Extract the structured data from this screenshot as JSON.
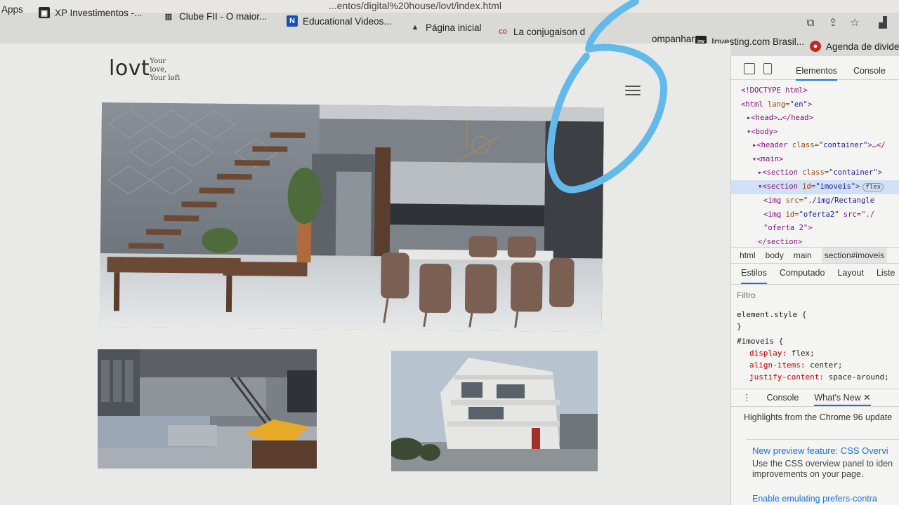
{
  "browser": {
    "url_fragment": "...entos/digital%20house/lovt/index.html",
    "bookmarks": [
      {
        "label": "Apps",
        "icon": "apps-grid-icon"
      },
      {
        "label": "XP Investimentos -...",
        "icon": "xp-favicon-icon"
      },
      {
        "label": "Clube FII - O maior...",
        "icon": "building-icon"
      },
      {
        "label": "Educational Videos...",
        "icon": "n-favicon-icon"
      },
      {
        "label": "Página inicial",
        "icon": "mountain-favicon-icon"
      },
      {
        "label": "La conjugaison d",
        "icon": "conjugaison-favicon-icon"
      },
      {
        "label": "ompanhar",
        "icon": "bookmark-icon"
      },
      {
        "label": "Investing.com Brasil...",
        "icon": "investing-favicon-icon"
      },
      {
        "label": "Agenda de dividen",
        "icon": "agenda-favicon-icon"
      }
    ]
  },
  "page": {
    "logo": "lovt",
    "tagline": [
      "Your",
      "love,",
      "Your loft"
    ],
    "hero_alt": "interior living and dining room with floating staircase",
    "thumb1_alt": "loft living room with mezzanine",
    "thumb2_alt": "modern building exterior"
  },
  "devtools": {
    "tabs": [
      "Elementos",
      "Console"
    ],
    "dom": [
      {
        "tag": "<!DOCTYPE html>"
      },
      {
        "tag": "<html ",
        "attr": "lang",
        "val": "\"en\"",
        "end": ">"
      },
      {
        "tag": "▸<head>…</head>"
      },
      {
        "tag": "▾<body>"
      },
      {
        "tag": "▸<header ",
        "attr": "class",
        "val": "\"container\"",
        "end": ">…</"
      },
      {
        "tag": "▾<main>"
      },
      {
        "tag": "▸<section ",
        "attr": "class",
        "val": "\"container\"",
        "end": ">"
      },
      {
        "tag": "▾<section ",
        "attr": "id",
        "val": "\"imoveis\"",
        "end": ">"
      },
      {
        "tag": "<img ",
        "attr": "src",
        "val": "\"./img/Rectangle",
        "end": ""
      },
      {
        "tag": "<img ",
        "attr": "id",
        "val": "\"oferta2\"",
        "end": " src=\"./"
      },
      {
        "tag": "\"oferta 2\">"
      },
      {
        "tag": "</section>"
      }
    ],
    "flex_badge": "flex",
    "breadcrumbs": [
      "html",
      "body",
      "main",
      "section#imoveis"
    ],
    "style_tabs": [
      "Estilos",
      "Computado",
      "Layout",
      "Liste"
    ],
    "filter_placeholder": "Filtro",
    "rules": [
      {
        "selector": "element.style {",
        "close": "}"
      },
      {
        "selector": "#imoveis {"
      }
    ],
    "props": [
      {
        "name": "display",
        "value": "flex;"
      },
      {
        "name": "align-items",
        "value": "center;"
      },
      {
        "name": "justify-content",
        "value": "space-around;"
      }
    ],
    "drawer_tabs": [
      "Console",
      "What's New"
    ],
    "highlights": "Highlights from the Chrome 96 update",
    "news_title": "New preview feature: CSS Overvi",
    "news_body": [
      "Use the CSS overview panel to iden",
      "improvements on your page."
    ],
    "news_2": "Enable emulating prefers-contra"
  },
  "annotation": {
    "label": "6",
    "color": "#62b9ea"
  }
}
